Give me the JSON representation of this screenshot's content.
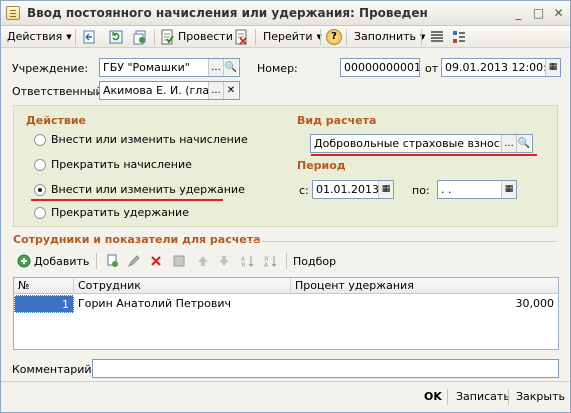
{
  "window": {
    "title": "Ввод постоянного начисления или удержания: Проведен",
    "minimize": "_",
    "maximize": "□",
    "close": "✕"
  },
  "toolbar": {
    "actions": "Действия",
    "post": "Провести",
    "goto": "Перейти",
    "help": "?",
    "fill": "Заполнить"
  },
  "header": {
    "institution_label": "Учреждение:",
    "institution_value": "ГБУ \"Ромашки\"",
    "number_label": "Номер:",
    "number_value": "00000000001",
    "from_label": "от",
    "date_value": "09.01.2013 12:00:00",
    "responsible_label": "Ответственный:",
    "responsible_value": "Акимова Е. И. (главн"
  },
  "action_group": {
    "title": "Действие",
    "options": [
      "Внести или изменить начисление",
      "Прекратить начисление",
      "Внести или изменить удержание",
      "Прекратить удержание"
    ],
    "selected_index": 2
  },
  "calc_type": {
    "title": "Вид расчета",
    "value": "Добровольные страховые взносы в"
  },
  "period": {
    "title": "Период",
    "from_label": "с:",
    "from_value": "01.01.2013",
    "to_label": "по:",
    "to_value": " .  ."
  },
  "employees": {
    "section_title": "Сотрудники и показатели для расчета",
    "add_label": "Добавить",
    "pick_label": "Подбор",
    "columns": [
      "№",
      "Сотрудник",
      "Процент удержания"
    ],
    "rows": [
      {
        "num": "1",
        "employee": "Горин Анатолий Петрович",
        "percent": "30,000"
      }
    ]
  },
  "comment": {
    "label": "Комментарий:",
    "value": ""
  },
  "footer": {
    "ok": "OK",
    "save": "Записать",
    "close": "Закрыть"
  },
  "colors": {
    "accent_text": "#b55a1d",
    "highlight": "#e21d1d",
    "panel": "#eaeed8"
  }
}
